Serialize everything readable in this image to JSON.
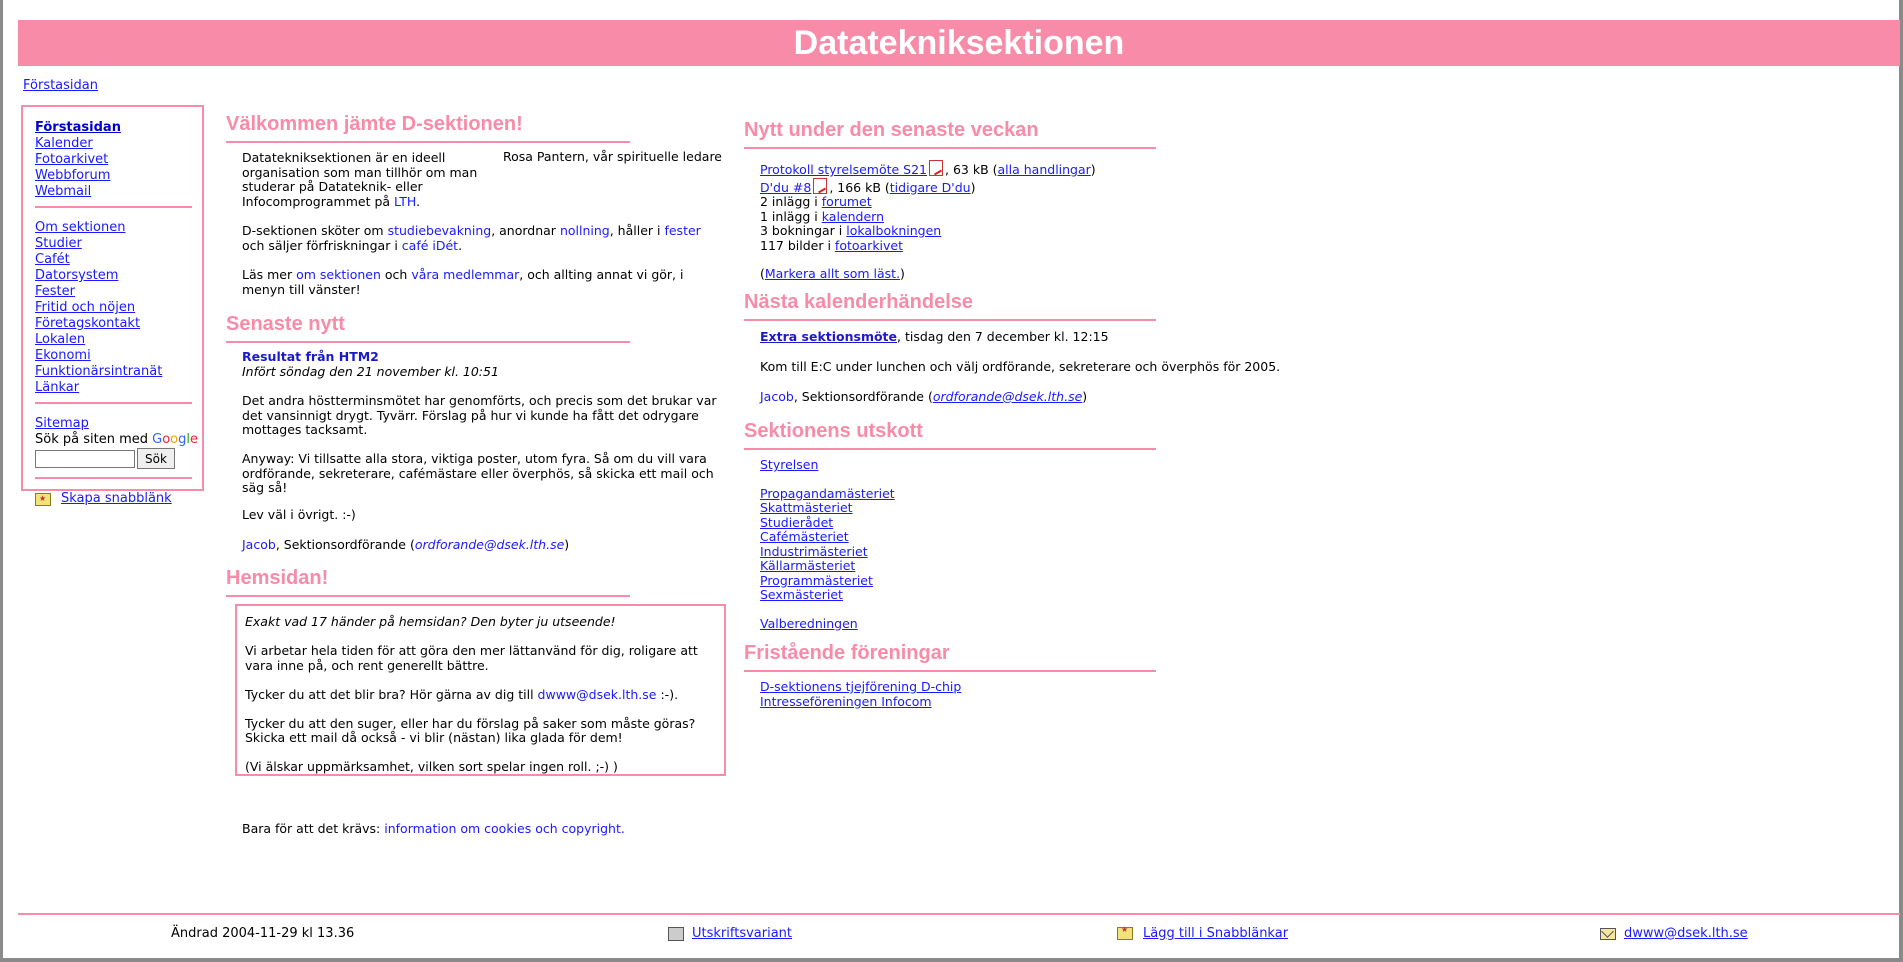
{
  "banner": {
    "title": "Datateknik­sektionen"
  },
  "breadcrumb": {
    "label": "Förstasidan"
  },
  "sidebar": {
    "group1": [
      "Förstasidan",
      "Kalender",
      "Fotoarkivet",
      "Webbforum",
      "Webmail"
    ],
    "group2": [
      "Om sektionen",
      "Studier",
      "Cafét",
      "Datorsystem",
      "Fester",
      "Fritid och nöjen",
      "Företagskontakt",
      "Lokalen",
      "Ekonomi",
      "Funktionärsintranät",
      "Länkar"
    ],
    "sitemap": "Sitemap",
    "search_label": "Sök på siten med",
    "google": [
      "G",
      "o",
      "o",
      "g",
      "l",
      "e"
    ],
    "search_button": "Sök",
    "snabb": "Skapa snabblänk"
  },
  "welcome": {
    "title": "Välkommen jämte D-sektionen!",
    "image_alt": "Rosa Pantern, vår spirituelle ledare",
    "p1": "Datateknik­sektionen är en ideell organisation som man tillhör om man studerar på Datateknik- eller Infocomprogrammet på",
    "p1_link": "LTH",
    "p2_a": "D-sektionen sköter om",
    "p2_l1": "studiebevakning",
    "p2_b": ", anordnar",
    "p2_l2": "nollning",
    "p2_c": ", håller i",
    "p2_l3": "fester",
    "p2_d": "och säljer förfriskningar i",
    "p2_l4": "café iDét",
    "p3_a": "Läs mer",
    "p3_l1": "om sektionen",
    "p3_b": "och",
    "p3_l2": "våra medlemmar",
    "p3_c": ", och allting annat vi gör, i menyn till vänster!"
  },
  "news": {
    "title": "Senaste nytt",
    "headline": "Resultat från HTM2",
    "dateline": "Infört söndag den 21 november kl. 10:51",
    "p1": "Det andra höstterminsmötet har genomförts, och precis som det brukar var det vansinnigt drygt. Tyvärr. Förslag på hur vi kunde ha fått det odrygare mottages tacksamt.",
    "p2": "Anyway: Vi tillsatte alla stora, viktiga poster, utom fyra. Så om du vill vara ordförande, sekreterare, cafémästare eller överphös, så skicka ett mail och säg så!",
    "p3": "Lev väl i övrigt. :-)",
    "sig_name": "Jacob",
    "sig_role": ", Sektionsordförande (",
    "sig_email": "ordforande@dsek.lth.se",
    "sig_end": ")"
  },
  "homepage": {
    "title": "Hemsidan!",
    "p1": "Exakt vad 17 händer på hemsidan? Den byter ju utseende!",
    "p2": "Vi arbetar hela tiden för att göra den mer lättanvänd för dig, roligare att vara inne på, och rent generellt bättre.",
    "p3_a": "Tycker du att det blir bra? Hör gärna av dig till",
    "p3_link": "dwww@dsek.lth.se",
    "p3_b": ":-).",
    "p4": "Tycker du att den suger, eller har du förslag på saker som måste göras? Skicka ett mail då också - vi blir (nästan) lika glada för dem!",
    "p5": "(Vi älskar uppmärksamhet, vilken sort spelar ingen roll. ;-) )"
  },
  "cookies": {
    "text": "Bara för att det krävs:",
    "link": "information om cookies och copyright."
  },
  "recent": {
    "title": "Nytt under den senaste veckan",
    "l1_link": "Protokoll styrelsemöte S21",
    "l1_size": ", 63 kB (",
    "l1_link2": "alla handlingar",
    "l1_end": ")",
    "l2_link": "D'du #8",
    "l2_size": ", 166 kB (",
    "l2_link2": "tidigare D'du",
    "l2_end": ")",
    "l3_a": "2 inlägg i",
    "l3_link": "forumet",
    "l4_a": "1 inlägg i",
    "l4_link": "kalendern",
    "l5_a": "3 bokningar i",
    "l5_link": "lokalbokningen",
    "l6_a": "117 bilder i",
    "l6_link": "fotoarkivet",
    "mark_a": "(",
    "mark_link": "Markera allt som läst.",
    "mark_b": ")"
  },
  "next_event": {
    "title": "Nästa kalenderhändelse",
    "event_link": "Extra sektionsmöte",
    "event_when": ", tisdag den 7 december kl. 12:15",
    "body": "Kom till E:C under lunchen och välj ordförande, sekreterare och överphös för 2005.",
    "sig_name": "Jacob",
    "sig_role": ", Sektionsordförande (",
    "sig_email": "ordforande@dsek.lth.se",
    "sig_end": ")"
  },
  "committees": {
    "title": "Sektionens utskott",
    "first": "Styrelsen",
    "list": [
      "Propagandamästeriet",
      "Skattmästeriet",
      "Studierådet",
      "Cafémästeriet",
      "Industrimästeriet",
      "Källarmästeriet",
      "Programmästeriet",
      "Sexmästeriet"
    ],
    "last": "Valberedningen"
  },
  "associations": {
    "title": "Fristående föreningar",
    "list": [
      "D-sektionens tjejförening D-chip",
      "Intresseföreningen Infocom"
    ]
  },
  "footer": {
    "changed": "Ändrad 2004-11-29 kl 13.36",
    "print": "Utskriftsvariant",
    "snabb": "Lägg till i Snabblänkar",
    "email": "dwww@dsek.lth.se"
  },
  "colors": {
    "accent": "#f78ba8",
    "link": "#1a1aff"
  }
}
